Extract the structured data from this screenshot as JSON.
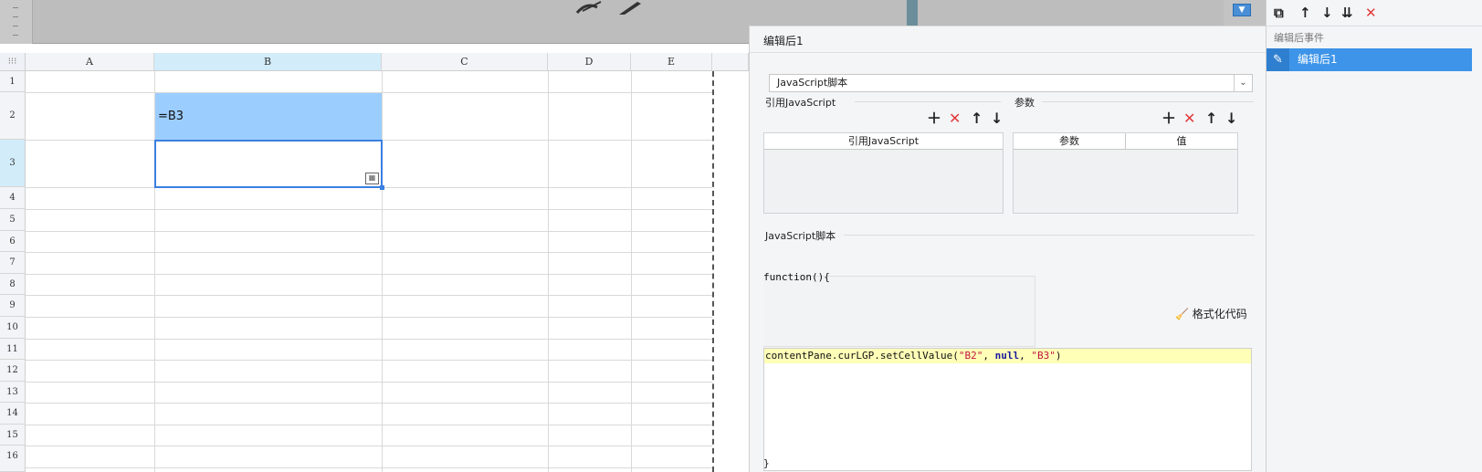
{
  "banner": {
    "dropdown_glyph": "▼"
  },
  "sheet": {
    "columns": [
      "A",
      "B",
      "C",
      "D",
      "E"
    ],
    "rows": [
      "1",
      "2",
      "3",
      "4",
      "5",
      "6",
      "7",
      "8",
      "9",
      "10",
      "11",
      "12",
      "13",
      "14",
      "15",
      "16"
    ],
    "selected_column": "B",
    "selected_row": "3",
    "cells": {
      "B2": "=B3",
      "B3": ""
    }
  },
  "dialog": {
    "title": "编辑后1",
    "script_type": "JavaScript脚本",
    "ref_section": "引用JavaScript",
    "param_section": "参数",
    "ref_table_header": "引用JavaScript",
    "param_table_headers": [
      "参数",
      "值"
    ],
    "script_section": "JavaScript脚本",
    "code_open": "function(){",
    "code_line": {
      "prefix": "contentPane.curLGP.setCellValue(",
      "arg1": "\"B2\"",
      "sep1": ", ",
      "arg2": "null",
      "sep2": ", ",
      "arg3": "\"B3\"",
      "suffix": ")"
    },
    "code_close": "}",
    "format_button": "格式化代码"
  },
  "event_panel": {
    "section_label": "编辑后事件",
    "items": [
      {
        "label": "编辑后1",
        "selected": true
      }
    ]
  },
  "colors": {
    "accent": "#3d94e8",
    "selected_cell": "#9ccdff",
    "code_highlight": "#ffffb8",
    "delete": "#e23b3b"
  }
}
